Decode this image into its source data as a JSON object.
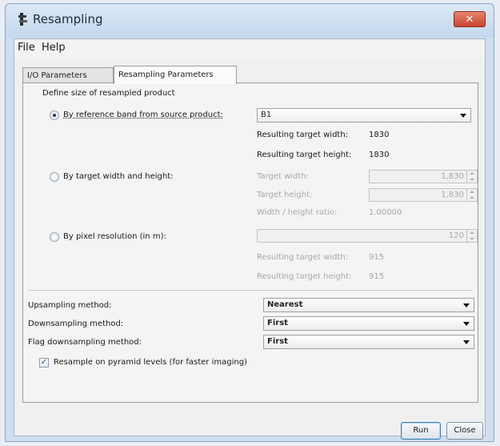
{
  "window": {
    "title": "Resampling",
    "close_glyph": "✕"
  },
  "menu": {
    "file": "File",
    "help": "Help"
  },
  "tabs": {
    "io": "I/O Parameters",
    "resampling": "Resampling Parameters"
  },
  "define_size": {
    "heading": "Define size of resampled product",
    "by_reference": {
      "label": "By reference band from source product:",
      "selected": true,
      "band_value": "B1",
      "result_width_label": "Resulting target width:",
      "result_width_value": "1830",
      "result_height_label": "Resulting target height:",
      "result_height_value": "1830"
    },
    "by_width_height": {
      "label": "By target width and height:",
      "selected": false,
      "target_width_label": "Target width:",
      "target_width_value": "1,830",
      "target_height_label": "Target height:",
      "target_height_value": "1,830",
      "ratio_label": "Width / height ratio:",
      "ratio_value": "1.00000"
    },
    "by_pixel_resolution": {
      "label": "By pixel resolution (in m):",
      "selected": false,
      "resolution_value": "120",
      "result_width_label": "Resulting target width:",
      "result_width_value": "915",
      "result_height_label": "Resulting target height:",
      "result_height_value": "915"
    }
  },
  "methods": {
    "upsampling_label": "Upsampling method:",
    "upsampling_value": "Nearest",
    "downsampling_label": "Downsampling method:",
    "downsampling_value": "First",
    "flag_downsampling_label": "Flag downsampling method:",
    "flag_downsampling_value": "First"
  },
  "pyramid": {
    "label": "Resample on pyramid levels (for faster imaging)",
    "checked": true,
    "check_glyph": "✓"
  },
  "buttons": {
    "run": "Run",
    "close": "Close"
  }
}
